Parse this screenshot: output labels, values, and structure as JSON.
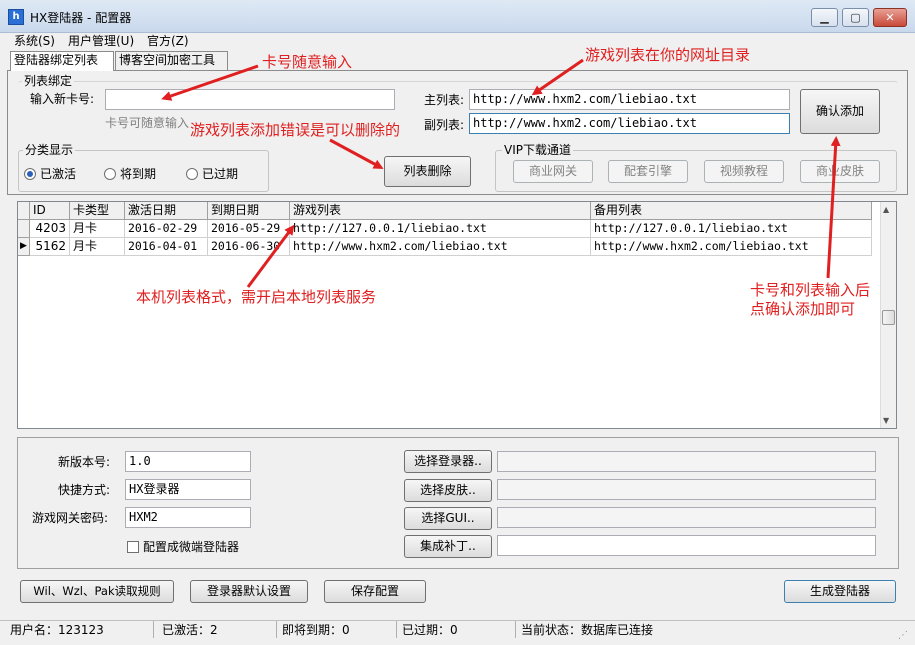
{
  "window": {
    "title": "HX登陆器 - 配置器",
    "icon": "h-icon"
  },
  "menu": [
    "系统(S)",
    "用户管理(U)",
    "官方(Z)"
  ],
  "tabs": [
    "登陆器绑定列表",
    "博客空间加密工具"
  ],
  "bind_group": {
    "title": "列表绑定",
    "card_label": "输入新卡号:",
    "card_value": "",
    "card_hint": "卡号可随意输入",
    "main_list_label": "主列表:",
    "main_list_value": "http://www.hxm2.com/liebiao.txt",
    "sub_list_label": "副列表:",
    "sub_list_value": "http://www.hxm2.com/liebiao.txt",
    "confirm_button": "确认添加",
    "delete_button": "列表删除"
  },
  "filter_group": {
    "title": "分类显示",
    "options": [
      "已激活",
      "将到期",
      "已过期"
    ],
    "selected": 0
  },
  "vip_group": {
    "title": "VIP下载通道",
    "buttons": [
      "商业网关",
      "配套引擎",
      "视频教程",
      "商业皮肤"
    ]
  },
  "table": {
    "columns": [
      "ID",
      "卡类型",
      "激活日期",
      "到期日期",
      "游戏列表",
      "备用列表"
    ],
    "rows": [
      [
        "4203",
        "月卡",
        "2016-02-29",
        "2016-05-29",
        "http://127.0.0.1/liebiao.txt",
        "http://127.0.0.1/liebiao.txt"
      ],
      [
        "5162",
        "月卡",
        "2016-04-01",
        "2016-06-30",
        "http://www.hxm2.com/liebiao.txt",
        "http://www.hxm2.com/liebiao.txt"
      ]
    ],
    "current_row": 1
  },
  "settings": {
    "version_label": "新版本号:",
    "version_value": "1.0",
    "shortcut_label": "快捷方式:",
    "shortcut_value": "HX登录器",
    "gateway_pwd_label": "游戏网关密码:",
    "gateway_pwd_value": "HXM2",
    "micro_checkbox": "配置成微端登陆器",
    "micro_checked": false,
    "pick_buttons": [
      "选择登录器..",
      "选择皮肤..",
      "选择GUI..",
      "集成补丁.."
    ]
  },
  "bottom_buttons": [
    "Wil、Wzl、Pak读取规则",
    "登录器默认设置",
    "保存配置",
    "生成登陆器"
  ],
  "status": {
    "user": "用户名：123123",
    "active": "已激活：2",
    "expiring": "即将到期：0",
    "expired": "已过期：0",
    "state": "当前状态：数据库已连接"
  },
  "annotations": {
    "card_random": "卡号随意输入",
    "list_dir": "游戏列表在你的网址目录",
    "list_delete": "游戏列表添加错误是可以删除的",
    "local_format": "本机列表格式，需开启本地列表服务",
    "confirm_hint_1": "卡号和列表输入后",
    "confirm_hint_2": "点确认添加即可"
  },
  "colors": {
    "annotation": "#e02020",
    "accent": "#2b5fb8"
  }
}
